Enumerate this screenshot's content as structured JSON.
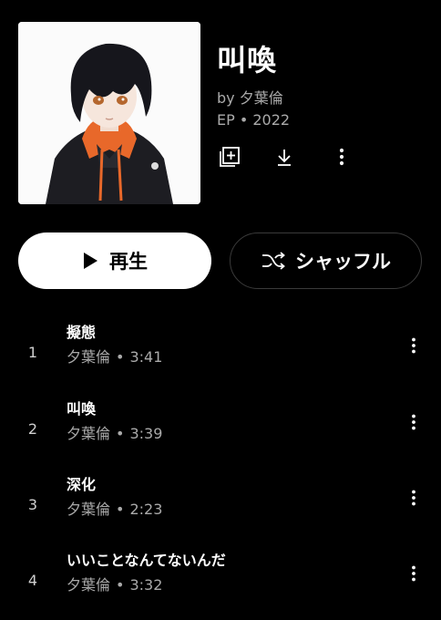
{
  "album": {
    "title": "叫喚",
    "artist_line": "by 夕葉倫",
    "meta_line": "EP • 2022",
    "cover_icon": "album-cover-art"
  },
  "actions": {
    "add_icon": "add-to-library-icon",
    "download_icon": "download-icon",
    "more_icon": "more-vert-icon"
  },
  "buttons": {
    "play_label": "再生",
    "shuffle_label": "シャッフル"
  },
  "tracks": [
    {
      "number": "1",
      "title": "擬態",
      "artist": "夕葉倫",
      "separator": "•",
      "duration": "3:41"
    },
    {
      "number": "2",
      "title": "叫喚",
      "artist": "夕葉倫",
      "separator": "•",
      "duration": "3:39"
    },
    {
      "number": "3",
      "title": "深化",
      "artist": "夕葉倫",
      "separator": "•",
      "duration": "2:23"
    },
    {
      "number": "4",
      "title": "いいことなんてないんだ",
      "artist": "夕葉倫",
      "separator": "•",
      "duration": "3:32"
    }
  ],
  "colors": {
    "background": "#000000",
    "primary_text": "#ffffff",
    "secondary_text": "#aaaaaa",
    "accent_orange": "#e8682a"
  }
}
